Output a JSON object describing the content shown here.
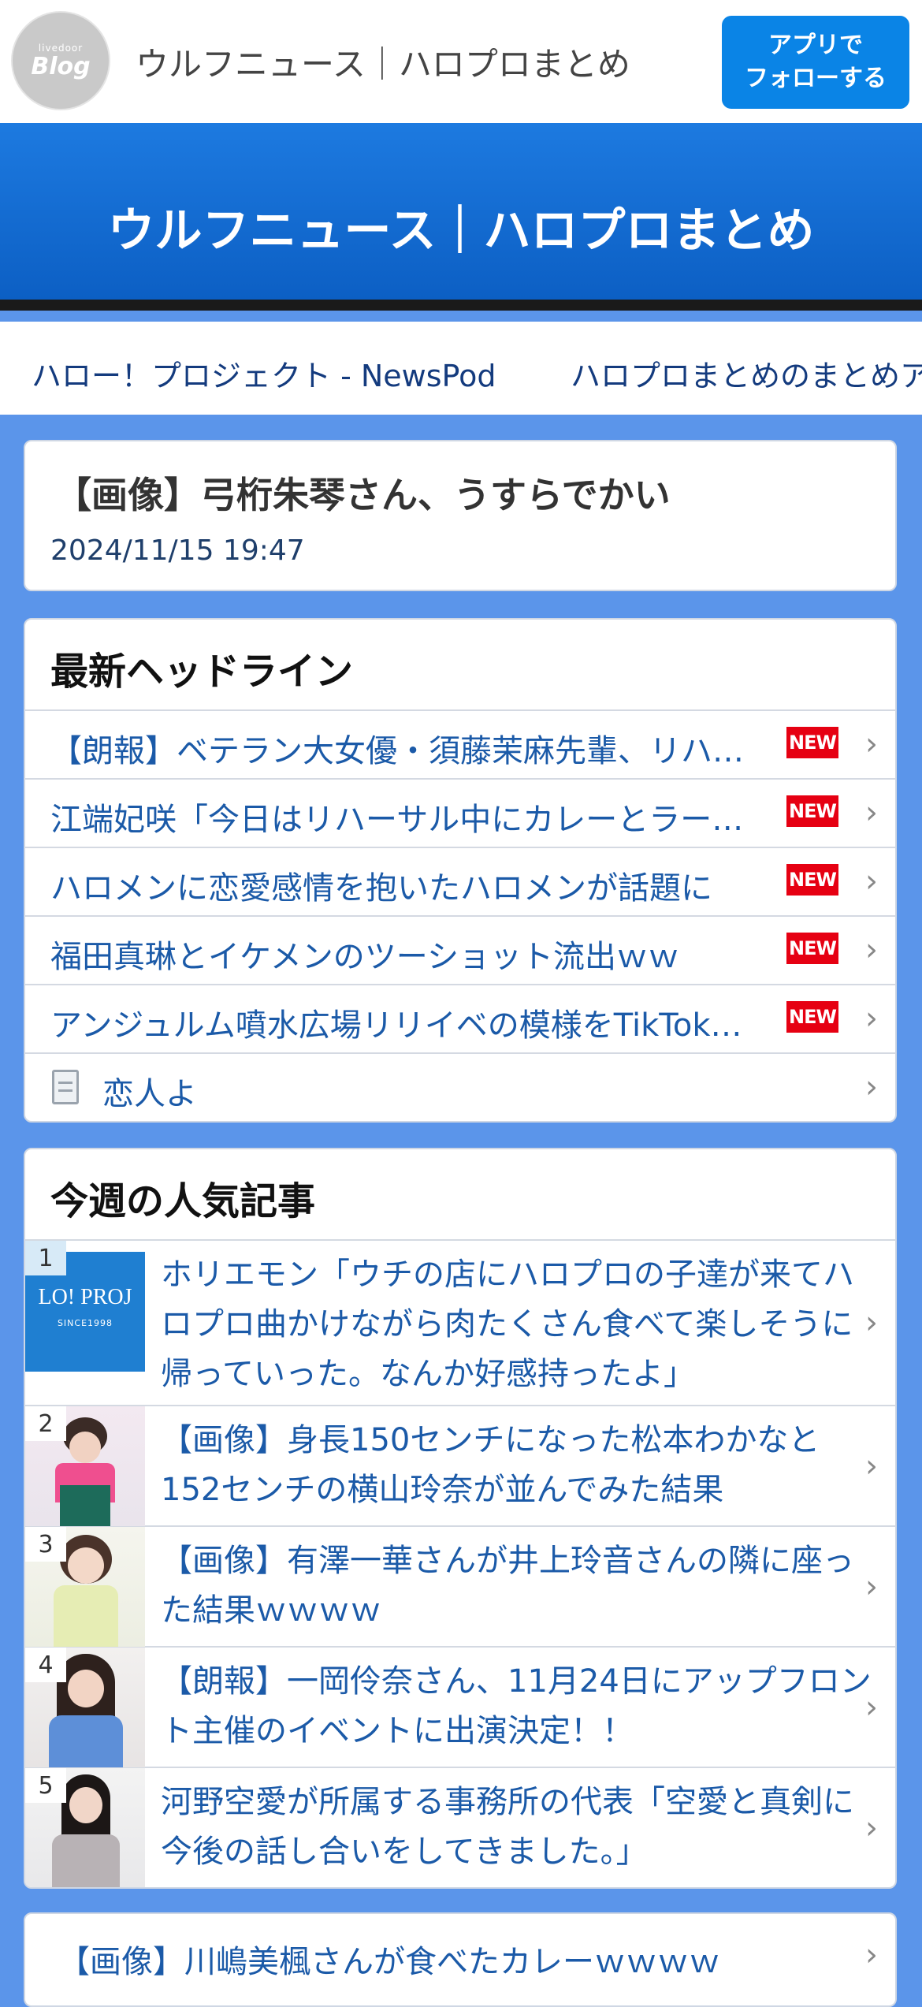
{
  "topbar": {
    "logo_small": "livedoor",
    "logo_big": "Blog",
    "title": "ウルフニュース｜ハロプロまとめ",
    "follow_line1": "アプリで",
    "follow_line2": "フォローする"
  },
  "banner": {
    "title": "ウルフニュース｜ハロプロまとめ"
  },
  "links": [
    "ハロー！プロジェクト - NewsPod",
    "ハロプロまとめのまとめア"
  ],
  "article": {
    "title": "【画像】弓桁朱琴さん、うすらでかい",
    "date": "2024/11/15 19:47"
  },
  "headlines": {
    "heading": "最新ヘッドライン",
    "badge": "NEW",
    "items": [
      {
        "text": "【朗報】ベテラン大女優・須藤茉麻先輩、リハ…"
      },
      {
        "text": "江端妃咲「今日はリハーサル中にカレーとラー…"
      },
      {
        "text": "ハロメンに恋愛感情を抱いたハロメンが話題に"
      },
      {
        "text": "福田真琳とイケメンのツーショット流出ｗｗ"
      },
      {
        "text": "アンジュルム噴水広場リリイベの模様をTikTok…"
      },
      {
        "text": "恋人よ"
      }
    ]
  },
  "popular": {
    "heading": "今週の人気記事",
    "items": [
      {
        "rank": "1",
        "text": "ホリエモン「ウチの店にハロプロの子達が来てハロプロ曲かけながら肉たくさん食べて楽しそうに帰っていった。なんか好感持ったよ」",
        "thumb_text": "LO! PROJ",
        "thumb_sub": "SINCE1998"
      },
      {
        "rank": "2",
        "text": "【画像】身長150センチになった松本わかなと152センチの横山玲奈が並んでみた結果"
      },
      {
        "rank": "3",
        "text": "【画像】有澤一華さんが井上玲音さんの隣に座った結果ｗｗｗｗ"
      },
      {
        "rank": "4",
        "text": "【朗報】一岡伶奈さん、11月24日にアップフロント主催のイベントに出演決定！！"
      },
      {
        "rank": "5",
        "text": "河野空愛が所属する事務所の代表「空愛と真剣に今後の話し合いをしてきました。」"
      }
    ]
  },
  "bottom": {
    "text": "【画像】川嶋美楓さんが食べたカレーｗｗｗｗ"
  },
  "colors": {
    "accent": "#0a84e6",
    "background": "#5b95ea",
    "link": "#1b5aa8",
    "badge": "#e60012"
  }
}
